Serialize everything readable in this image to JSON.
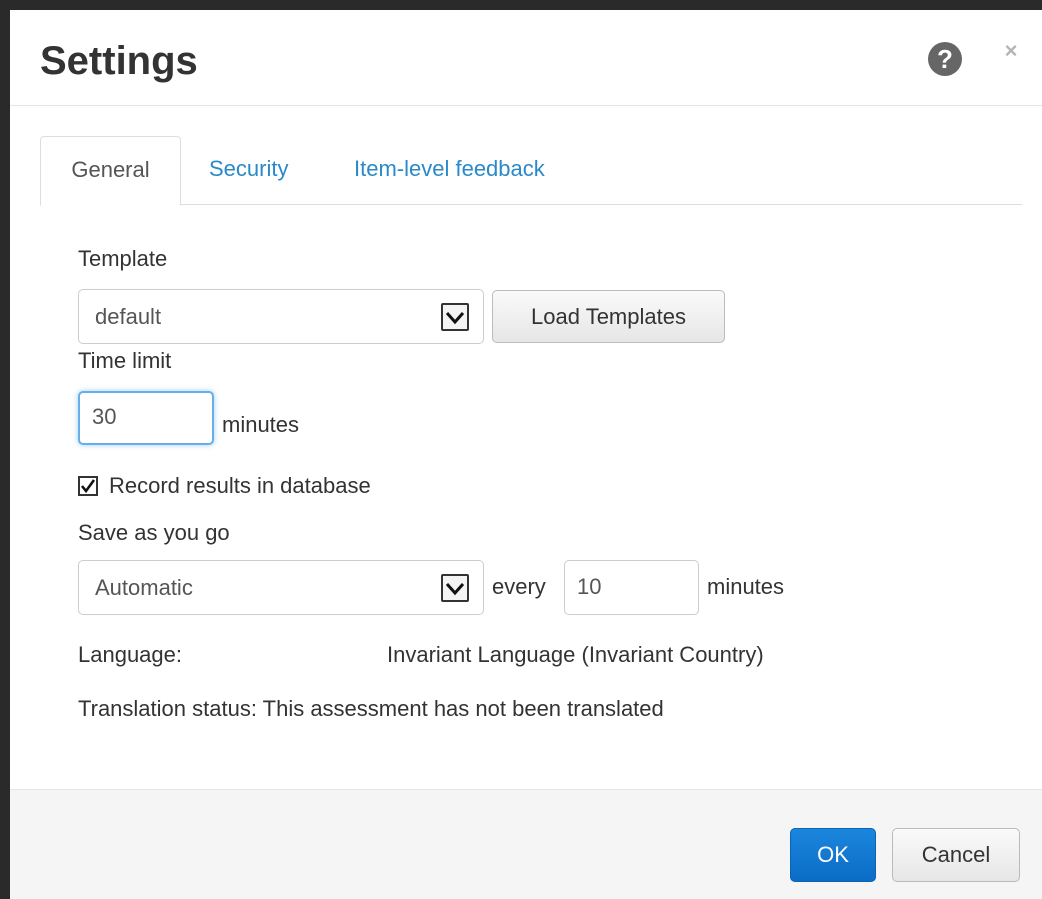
{
  "dialog": {
    "title": "Settings",
    "help_icon": "question-circle-icon",
    "help_glyph": "?",
    "close_icon": "close-icon",
    "close_glyph": "×"
  },
  "tabs": [
    {
      "label": "General",
      "active": true
    },
    {
      "label": "Security",
      "active": false
    },
    {
      "label": "Item-level feedback",
      "active": false
    }
  ],
  "general": {
    "template_label": "Template",
    "template_value": "default",
    "load_templates_label": "Load Templates",
    "time_limit_label": "Time limit",
    "time_limit_value": "30",
    "time_limit_unit": "minutes",
    "record_results_label": "Record results in database",
    "record_results_checked": true,
    "save_as_you_go_label": "Save as you go",
    "save_mode_value": "Automatic",
    "every_label": "every",
    "save_interval_value": "10",
    "save_interval_unit": "minutes",
    "language_label": "Language:",
    "language_value": "Invariant Language (Invariant Country)",
    "translation_status": "Translation status: This assessment has not been translated"
  },
  "footer": {
    "ok_label": "OK",
    "cancel_label": "Cancel"
  },
  "colors": {
    "link": "#2a8ac9",
    "primary_button": "#0b6cc6",
    "focus_ring": "#66afe9"
  }
}
